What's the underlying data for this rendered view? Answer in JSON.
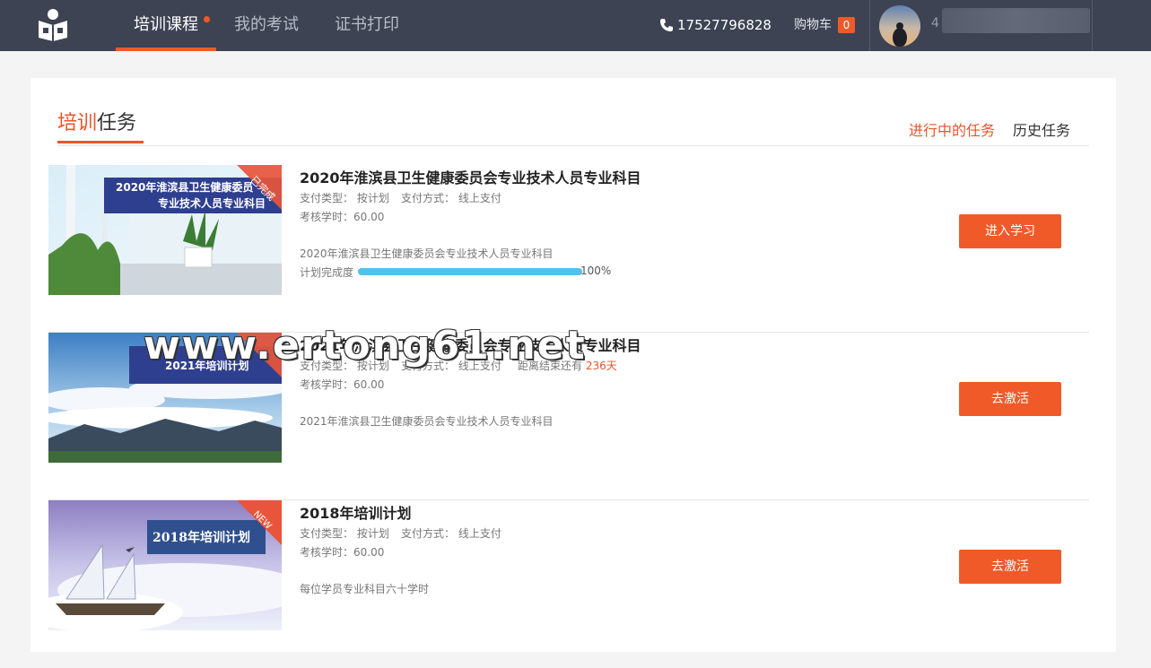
{
  "nav": {
    "tabs": [
      {
        "label": "培训课程"
      },
      {
        "label": "我的考试"
      },
      {
        "label": "证书打印"
      }
    ],
    "phone": "17527796828",
    "cart_label": "购物车",
    "cart_count": "0",
    "username": "4"
  },
  "panel": {
    "title_accent": "培训",
    "title_rest": "任务",
    "tabs": [
      "进行中的任务",
      "历史任务"
    ]
  },
  "tasks": [
    {
      "thumb_title_line1": "2020年淮滨县卫生健康委员",
      "thumb_title_line2": "专业技术人员专业科目",
      "ribbon": "已完成",
      "name": "2020年淮滨县卫生健康委员会专业技术人员专业科目",
      "pay_type": "支付类型： 按计划",
      "pay_method": "支付方式： 线上支付",
      "hours": "考核学时：60.00",
      "desc": "2020年淮滨县卫生健康委员会专业技术人员专业科目",
      "progress_label": "计划完成度",
      "progress": 1.0,
      "progress_text": "100%",
      "button": "进入学习"
    },
    {
      "thumb_title_line1": "2021年培训计划",
      "name": "2021年淮滨县卫生健康委员会专业技术人员专业科目",
      "pay_type": "支付类型： 按计划",
      "pay_method": "支付方式： 线上支付",
      "deadline_label": "距离结束还有",
      "deadline_days": "236天",
      "hours": "考核学时：60.00",
      "desc": "2021年淮滨县卫生健康委员会专业技术人员专业科目",
      "button": "去激活"
    },
    {
      "thumb_title_line1": "2018年培训计划",
      "ribbon": "NEW",
      "name": "2018年培训计划",
      "pay_type": "支付类型： 按计划",
      "pay_method": "支付方式： 线上支付",
      "hours": "考核学时：60.00",
      "desc": "每位学员专业科目六十学时",
      "button": "去激活"
    }
  ],
  "watermark": "www.ertong61.net",
  "colors": {
    "nav_bg": "#3d4353",
    "accent": "#f05a28",
    "progress": "#4fc3ea"
  }
}
